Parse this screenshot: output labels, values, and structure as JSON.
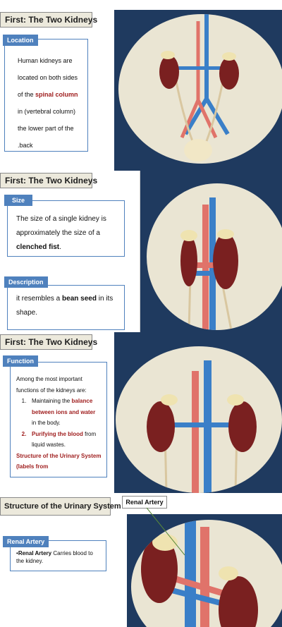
{
  "slides": [
    {
      "title": "First: The Two Kidneys",
      "tag": "Location",
      "lines": [
        {
          "pre": "Human kidneys are",
          "hl": "",
          "post": ""
        },
        {
          "pre": "located on both sides",
          "hl": "",
          "post": ""
        },
        {
          "pre": "of the ",
          "hl": "spinal column",
          "post": ""
        },
        {
          "pre": "in (vertebral column)",
          "hl": "",
          "post": ""
        },
        {
          "pre": "the lower part of the",
          "hl": "",
          "post": ""
        },
        {
          "pre": ".back",
          "hl": "",
          "post": ""
        }
      ]
    },
    {
      "title": "First: The Two Kidneys",
      "size_tag": "Size",
      "size_line1": "The size of a single kidney is",
      "size_line2": "approximately the size of a",
      "size_bold": "clenched fist",
      "size_end": ".",
      "desc_tag": "Description",
      "desc_pre": "it resembles a ",
      "desc_bold": "bean seed",
      "desc_post": " in its",
      "desc_line2": "shape."
    },
    {
      "title": "First: The Two Kidneys",
      "tag": "Function",
      "intro1": "Among the most important",
      "intro2": "functions of the kidneys are:",
      "item1_num": "1.",
      "item1_pre": "Maintaining the ",
      "item1_red1": "balance",
      "item1_red2": "between ions and water",
      "item1_post": "in the body.",
      "item2_num": "2.",
      "item2_red": "Purifying the blood",
      "item2_post": " from",
      "item2_line2": "liquid wastes.",
      "footer1": "Structure of the Urinary System",
      "footer2": "(labels from"
    },
    {
      "title": "Structure of the Urinary System",
      "callout": "Renal Artery",
      "tag": "Renal Artery",
      "bullet": "•",
      "term": "Renal Artery",
      "desc": " Carries blood to",
      "desc2": "the kidney."
    }
  ],
  "colors": {
    "navy": "#1f3a5f",
    "tag_blue": "#4f81bd",
    "highlight_red": "#a02020",
    "kidney": "#7a2020",
    "vein_blue": "#3a7fc8",
    "artery_red": "#e0736a",
    "oval_bg": "#eae5d3"
  }
}
